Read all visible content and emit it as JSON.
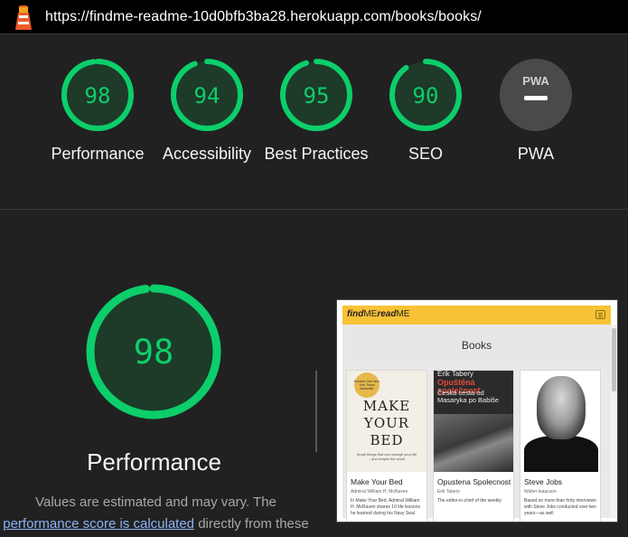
{
  "url": "https://findme-readme-10d0bfb3ba28.herokuapp.com/books/books/",
  "icons": {
    "logo": "lighthouse-icon",
    "pwa": "pwa-icon"
  },
  "colors": {
    "pass": "#0cce6b",
    "pwa": "#4a4a4a",
    "link": "#8ab4f8"
  },
  "gauges": [
    {
      "score": "98",
      "label": "Performance"
    },
    {
      "score": "94",
      "label": "Accessibility"
    },
    {
      "score": "95",
      "label": "Best Practices"
    },
    {
      "score": "90",
      "label": "SEO"
    },
    {
      "score": "PWA",
      "label": "PWA"
    }
  ],
  "main": {
    "score": "98",
    "title": "Performance",
    "desc_pre": "Values are estimated and may vary. The",
    "desc_link": "performance score is calculated",
    "desc_post": "directly from these"
  },
  "screenshot": {
    "brand_find": "find",
    "brand_me1": "ME",
    "brand_read": "read",
    "brand_me2": "ME",
    "header": "Books",
    "books": [
      {
        "title": "Make Your Bed",
        "author": "Admiral William H. McRaven",
        "blurb": "In Make Your Bed, Admiral William H. McRaven shares 10 life lessons he learned during his Navy Seal",
        "cover_badge": "Number One New York Times Bestseller",
        "cover_text": "MAKE YOUR BED",
        "cover_sub": "Small things that can change your life ...and maybe the world"
      },
      {
        "title": "Opustena Spolecnost",
        "author": "Erik Tabery",
        "blurb": "The editor-in-chief of the weekly",
        "cover_t1": "Erik Tabery",
        "cover_t2": "Opuštěná společnost",
        "cover_t3": "Česká cesta od Masaryka po Babiše"
      },
      {
        "title": "Steve Jobs",
        "author": "Walter Isaacson",
        "blurb": "Based on more than forty interviews with Steve Jobs conducted over two years—as well"
      }
    ]
  }
}
